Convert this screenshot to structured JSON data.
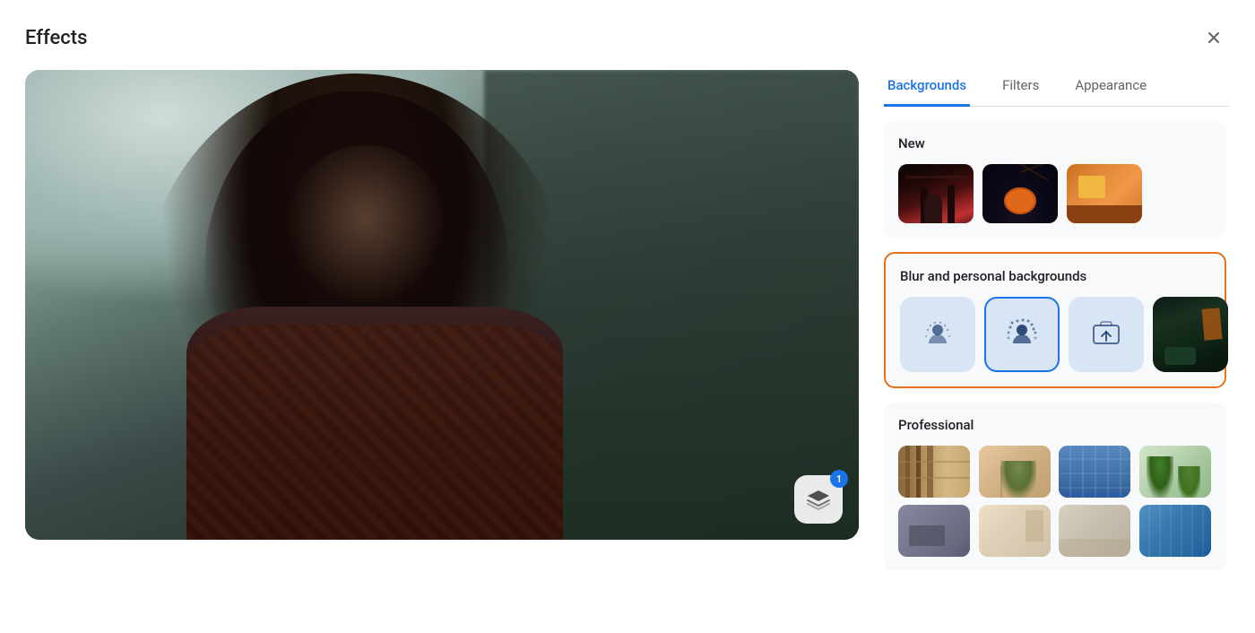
{
  "dialog": {
    "title": "Effects",
    "close_label": "×"
  },
  "tabs": [
    {
      "id": "backgrounds",
      "label": "Backgrounds",
      "active": true
    },
    {
      "id": "filters",
      "label": "Filters",
      "active": false
    },
    {
      "id": "appearance",
      "label": "Appearance",
      "active": false
    }
  ],
  "new_section": {
    "title": "New",
    "backgrounds": [
      {
        "id": "halloween-church",
        "label": "Gothic church background"
      },
      {
        "id": "halloween-pumpkin",
        "label": "Halloween pumpkin background"
      },
      {
        "id": "cozy-room",
        "label": "Cozy room background"
      }
    ]
  },
  "blur_section": {
    "title": "Blur and personal backgrounds",
    "items": [
      {
        "id": "slight-blur",
        "label": "Slight blur",
        "selected": false
      },
      {
        "id": "full-blur",
        "label": "Full blur",
        "selected": true
      },
      {
        "id": "upload",
        "label": "Upload background",
        "selected": false
      },
      {
        "id": "custom",
        "label": "Custom background",
        "selected": false
      }
    ]
  },
  "professional_section": {
    "title": "Professional",
    "backgrounds": [
      {
        "id": "p1",
        "label": "Bookshelf 1"
      },
      {
        "id": "p2",
        "label": "Beige wall"
      },
      {
        "id": "p3",
        "label": "City blue"
      },
      {
        "id": "p4",
        "label": "Green plants"
      },
      {
        "id": "p5",
        "label": "Office grey"
      },
      {
        "id": "p6",
        "label": "Warm minimal"
      },
      {
        "id": "p7",
        "label": "Light minimal"
      },
      {
        "id": "p8",
        "label": "Blue office"
      }
    ]
  },
  "badge": {
    "count": "1"
  },
  "colors": {
    "active_tab": "#1a73e8",
    "highlight_border": "#e8711a",
    "selected_thumb_border": "#1a73e8"
  }
}
